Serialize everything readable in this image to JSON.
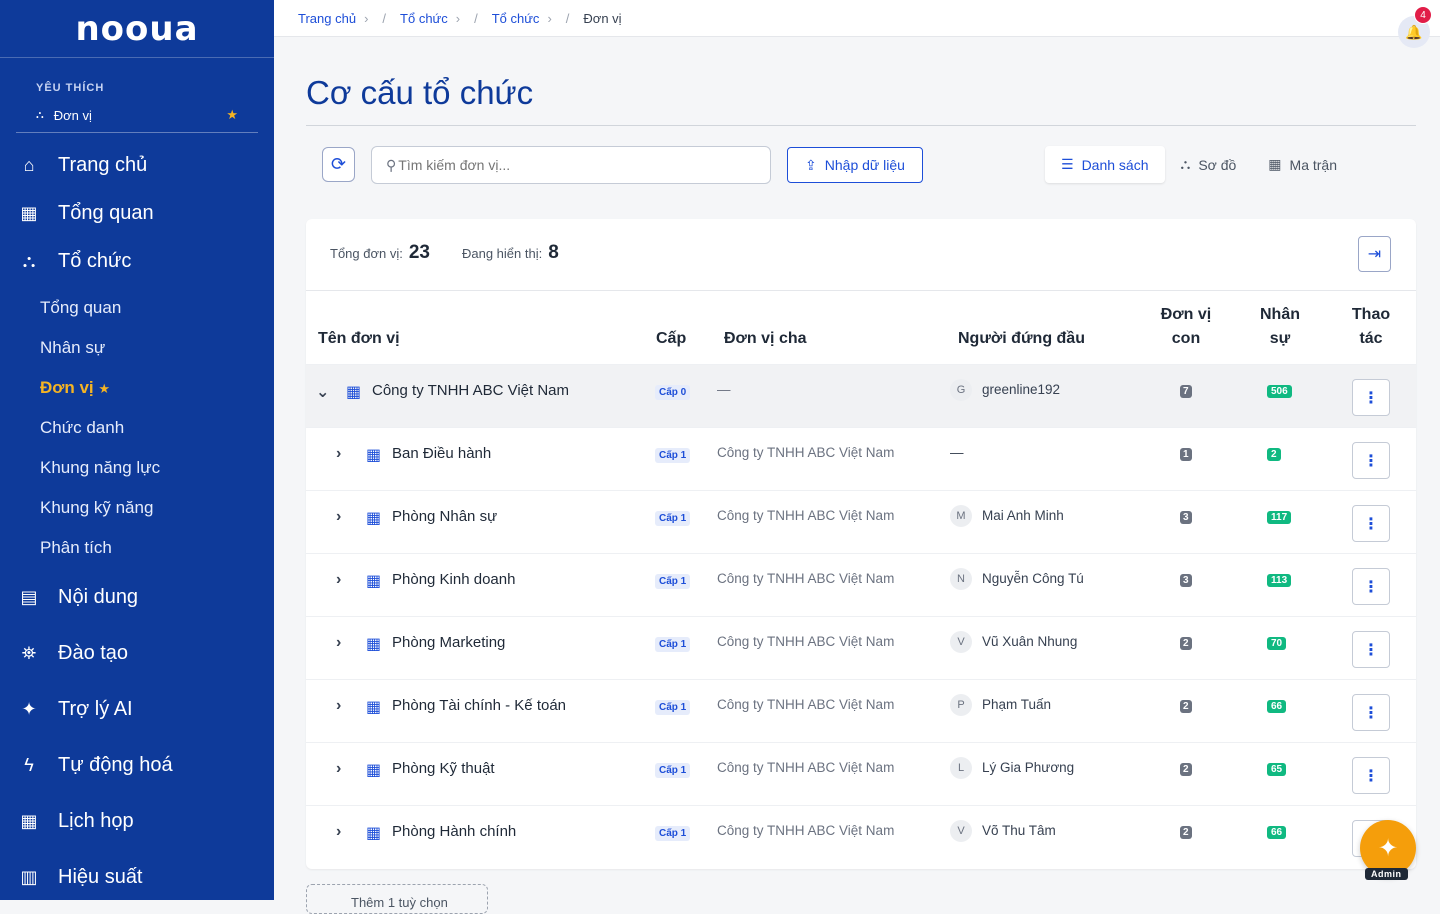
{
  "app": {
    "logo": "nooua"
  },
  "sidebar": {
    "favorites_title": "YÊU THÍCH",
    "favorite_item": "Đơn vị",
    "items": [
      {
        "label": "Trang chủ",
        "icon": "home-icon"
      },
      {
        "label": "Tổng quan",
        "icon": "grid-icon"
      },
      {
        "label": "Tổ chức",
        "icon": "org-chart-icon"
      },
      {
        "label": "Nội dung",
        "icon": "book-icon"
      },
      {
        "label": "Đào tạo",
        "icon": "graduation-cap-icon"
      },
      {
        "label": "Trợ lý AI",
        "icon": "sparkle-icon"
      },
      {
        "label": "Tự động hoá",
        "icon": "bolt-icon"
      },
      {
        "label": "Lịch họp",
        "icon": "calendar-icon"
      },
      {
        "label": "Hiệu suất",
        "icon": "bar-chart-icon"
      }
    ],
    "subitems": [
      "Tổng quan",
      "Nhân sự",
      "Đơn vị",
      "Chức danh",
      "Khung năng lực",
      "Khung kỹ năng",
      "Phân tích"
    ]
  },
  "breadcrumb": [
    "Trang chủ",
    "Tổ chức",
    "Tổ chức",
    "Đơn vị"
  ],
  "notifications": {
    "count": "4"
  },
  "page": {
    "title": "Cơ cấu tổ chức"
  },
  "toolbar": {
    "search_placeholder": "Tìm kiếm đơn vị...",
    "import_label": "Nhập dữ liệu",
    "views": [
      "Danh sách",
      "Sơ đồ",
      "Ma trận"
    ]
  },
  "stats": {
    "total_label": "Tổng đơn vị:",
    "total": "23",
    "showing_label": "Đang hiển thị:",
    "showing": "8"
  },
  "table": {
    "headers": {
      "name": "Tên đơn vị",
      "level": "Cấp",
      "parent": "Đơn vị cha",
      "head": "Người đứng đầu",
      "children_1": "Đơn vị",
      "children_2": "con",
      "staff_1": "Nhân",
      "staff_2": "sự",
      "action_1": "Thao",
      "action_2": "tác"
    },
    "rows": [
      {
        "name": "Công ty TNHH ABC Việt Nam",
        "level": "Cấp 0",
        "parent": "—",
        "initial": "G",
        "head": "greenline192",
        "children": "7",
        "staff": "506"
      },
      {
        "name": "Ban Điều hành",
        "level": "Cấp 1",
        "parent": "Công ty TNHH ABC Việt Nam",
        "initial": "",
        "head": "—",
        "children": "1",
        "staff": "2"
      },
      {
        "name": "Phòng Nhân sự",
        "level": "Cấp 1",
        "parent": "Công ty TNHH ABC Việt Nam",
        "initial": "M",
        "head": "Mai Anh Minh",
        "children": "3",
        "staff": "117"
      },
      {
        "name": "Phòng Kinh doanh",
        "level": "Cấp 1",
        "parent": "Công ty TNHH ABC Việt Nam",
        "initial": "N",
        "head": "Nguyễn Công Tú",
        "children": "3",
        "staff": "113"
      },
      {
        "name": "Phòng Marketing",
        "level": "Cấp 1",
        "parent": "Công ty TNHH ABC Việt Nam",
        "initial": "V",
        "head": "Vũ Xuân Nhung",
        "children": "2",
        "staff": "70"
      },
      {
        "name": "Phòng Tài chính - Kế toán",
        "level": "Cấp 1",
        "parent": "Công ty TNHH ABC Việt Nam",
        "initial": "P",
        "head": "Phạm Tuấn",
        "children": "2",
        "staff": "66"
      },
      {
        "name": "Phòng Kỹ thuật",
        "level": "Cấp 1",
        "parent": "Công ty TNHH ABC Việt Nam",
        "initial": "L",
        "head": "Lý Gia Phương",
        "children": "2",
        "staff": "65"
      },
      {
        "name": "Phòng Hành chính",
        "level": "Cấp 1",
        "parent": "Công ty TNHH ABC Việt Nam",
        "initial": "V",
        "head": "Võ Thu Tâm",
        "children": "2",
        "staff": "66"
      }
    ]
  },
  "add_more": {
    "label": "Thêm 1 tuỳ chọn"
  },
  "fab": {
    "label": "Admin"
  },
  "colors": {
    "sidebar": "#0e3a9a",
    "accent": "#1d4ed8",
    "favorite": "#f5b423",
    "staff_badge": "#10b981",
    "fab": "#f59e0b"
  }
}
